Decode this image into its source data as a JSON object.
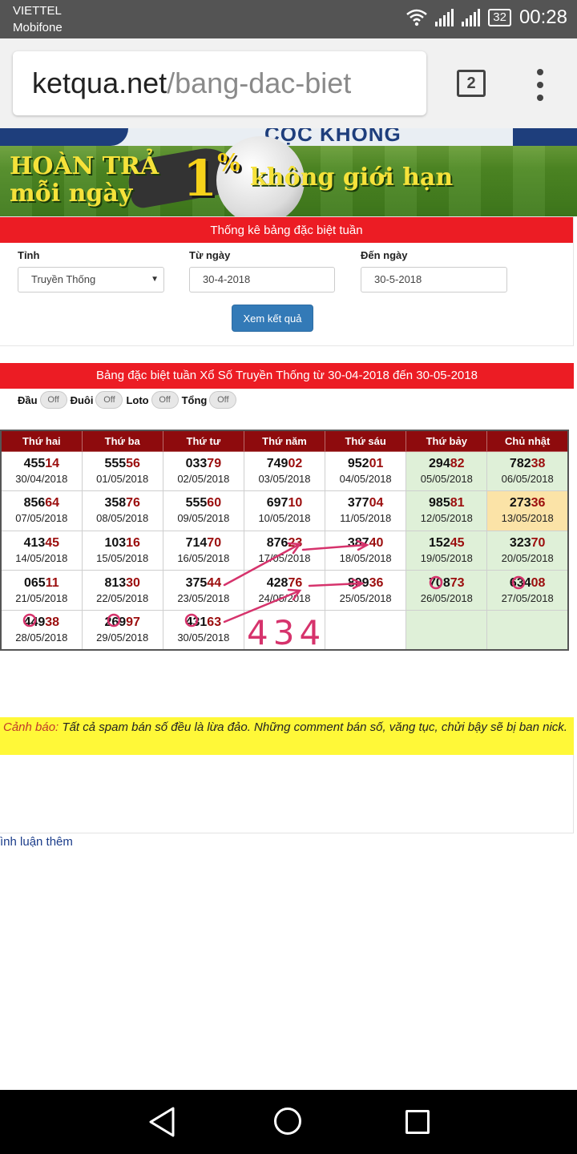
{
  "status_bar": {
    "carrier1": "VIETTEL",
    "carrier2": "Mobifone",
    "battery": "32",
    "time": "00:28"
  },
  "browser": {
    "url_host": "ketqua.net",
    "url_path": "/bang-dac-biet",
    "tab_count": "2"
  },
  "banner": {
    "top_text": "CỌC KHÔNG",
    "line1": "HOÀN TRẢ",
    "line2": "mỗi ngày",
    "percent": "1",
    "percent_sign": "%",
    "line3": "không giới hạn"
  },
  "filter": {
    "heading": "Thống kê bảng đặc biệt tuần",
    "province_label": "Tỉnh",
    "province_value": "Truyền Thống",
    "from_label": "Từ ngày",
    "from_value": "30-4-2018",
    "to_label": "Đến ngày",
    "to_value": "30-5-2018",
    "submit_label": "Xem kết quả"
  },
  "results": {
    "heading": "Bảng đặc biệt tuần Xổ Số Truyền Thống từ 30-04-2018 đến 30-05-2018",
    "toggles": [
      {
        "label": "Đầu",
        "state": "Off"
      },
      {
        "label": "Đuôi",
        "state": "Off"
      },
      {
        "label": "Loto",
        "state": "Off"
      },
      {
        "label": "Tổng",
        "state": "Off"
      }
    ],
    "columns": [
      "Thứ hai",
      "Thứ ba",
      "Thứ tư",
      "Thứ năm",
      "Thứ sáu",
      "Thứ bảy",
      "Chủ nhật"
    ],
    "rows": [
      [
        {
          "head": "455",
          "tail": "14",
          "date": "30/04/2018"
        },
        {
          "head": "555",
          "tail": "56",
          "date": "01/05/2018"
        },
        {
          "head": "033",
          "tail": "79",
          "date": "02/05/2018"
        },
        {
          "head": "749",
          "tail": "02",
          "date": "03/05/2018"
        },
        {
          "head": "952",
          "tail": "01",
          "date": "04/05/2018"
        },
        {
          "head": "294",
          "tail": "82",
          "date": "05/05/2018"
        },
        {
          "head": "782",
          "tail": "38",
          "date": "06/05/2018"
        }
      ],
      [
        {
          "head": "856",
          "tail": "64",
          "date": "07/05/2018"
        },
        {
          "head": "358",
          "tail": "76",
          "date": "08/05/2018"
        },
        {
          "head": "555",
          "tail": "60",
          "date": "09/05/2018"
        },
        {
          "head": "697",
          "tail": "10",
          "date": "10/05/2018"
        },
        {
          "head": "377",
          "tail": "04",
          "date": "11/05/2018"
        },
        {
          "head": "985",
          "tail": "81",
          "date": "12/05/2018"
        },
        {
          "head": "273",
          "tail": "36",
          "date": "13/05/2018"
        }
      ],
      [
        {
          "head": "413",
          "tail": "45",
          "date": "14/05/2018"
        },
        {
          "head": "103",
          "tail": "16",
          "date": "15/05/2018"
        },
        {
          "head": "714",
          "tail": "70",
          "date": "16/05/2018"
        },
        {
          "head": "876",
          "tail": "23",
          "date": "17/05/2018"
        },
        {
          "head": "387",
          "tail": "40",
          "date": "18/05/2018"
        },
        {
          "head": "152",
          "tail": "45",
          "date": "19/05/2018"
        },
        {
          "head": "323",
          "tail": "70",
          "date": "20/05/2018"
        }
      ],
      [
        {
          "head": "065",
          "tail": "11",
          "date": "21/05/2018"
        },
        {
          "head": "813",
          "tail": "30",
          "date": "22/05/2018"
        },
        {
          "head": "375",
          "tail": "44",
          "date": "23/05/2018"
        },
        {
          "head": "428",
          "tail": "76",
          "date": "24/05/2018"
        },
        {
          "head": "899",
          "tail": "36",
          "date": "25/05/2018"
        },
        {
          "head": "708",
          "tail": "73",
          "date": "26/05/2018"
        },
        {
          "head": "634",
          "tail": "08",
          "date": "27/05/2018"
        }
      ],
      [
        {
          "head": "449",
          "tail": "38",
          "date": "28/05/2018"
        },
        {
          "head": "269",
          "tail": "97",
          "date": "29/05/2018"
        },
        {
          "head": "431",
          "tail": "63",
          "date": "30/05/2018"
        },
        {
          "head": "",
          "tail": "",
          "date": ""
        },
        {
          "head": "",
          "tail": "",
          "date": ""
        },
        {
          "head": "",
          "tail": "",
          "date": ""
        },
        {
          "head": "",
          "tail": "",
          "date": ""
        }
      ]
    ],
    "handwritten_note": "434"
  },
  "warning": {
    "label": "Cảnh báo:",
    "text": "Tất cả spam bán số đều là lừa đảo. Những comment bán số, văng tục, chửi bậy sẽ bị ban nick."
  },
  "comments": {
    "more_label": "ình luận thêm"
  },
  "colors": {
    "red_bar": "#ec1c24",
    "table_header": "#8e0b0d",
    "weekend_cell": "#dff0d8",
    "highlight_cell": "#fbe3a7",
    "button_blue": "#337ab7",
    "warning_bg": "#fff838",
    "annotation_pink": "#d6336c"
  }
}
